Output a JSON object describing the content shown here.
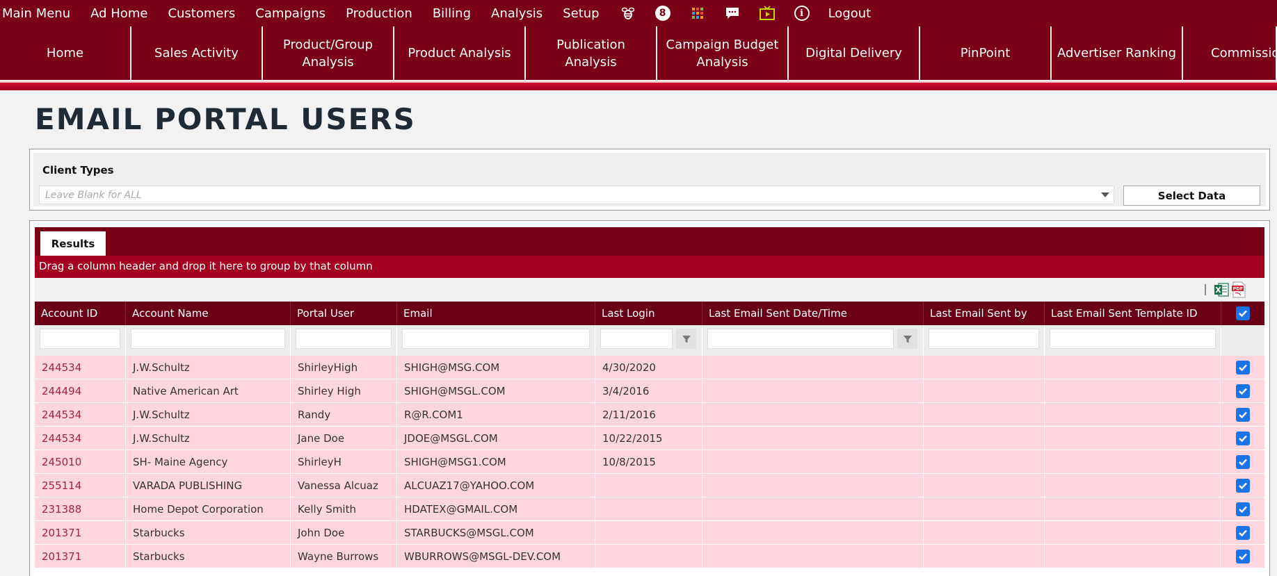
{
  "top_menu": {
    "items": [
      "Main Menu",
      "Ad Home",
      "Customers",
      "Campaigns",
      "Production",
      "Billing",
      "Analysis",
      "Setup"
    ],
    "notification_count": "8",
    "logout_label": "Logout"
  },
  "nav_tabs": [
    "Home",
    "Sales Activity",
    "Product/Group Analysis",
    "Product Analysis",
    "Publication Analysis",
    "Campaign Budget Analysis",
    "Digital Delivery",
    "PinPoint",
    "Advertiser Ranking",
    "Commissions"
  ],
  "page": {
    "title": "EMAIL PORTAL USERS"
  },
  "filters": {
    "client_types_label": "Client Types",
    "client_types_placeholder": "Leave Blank for ALL",
    "select_data_label": "Select Data"
  },
  "results": {
    "tab_label": "Results",
    "group_hint": "Drag a column header and drop it here to group by that column",
    "columns": [
      "Account ID",
      "Account Name",
      "Portal User",
      "Email",
      "Last Login",
      "Last Email Sent Date/Time",
      "Last Email Sent by",
      "Last Email Sent Template ID"
    ],
    "rows": [
      [
        "244534",
        "J.W.Schultz",
        "ShirleyHigh",
        "SHIGH@MSG.COM",
        "4/30/2020",
        "",
        "",
        ""
      ],
      [
        "244494",
        "Native American Art",
        "Shirley High",
        "SHIGH@MSGL.COM",
        "3/4/2016",
        "",
        "",
        ""
      ],
      [
        "244534",
        "J.W.Schultz",
        "Randy",
        "R@R.COM1",
        "2/11/2016",
        "",
        "",
        ""
      ],
      [
        "244534",
        "J.W.Schultz",
        "Jane Doe",
        "JDOE@MSGL.COM",
        "10/22/2015",
        "",
        "",
        ""
      ],
      [
        "245010",
        "SH- Maine Agency",
        "ShirleyH",
        "SHIGH@MSG1.COM",
        "10/8/2015",
        "",
        "",
        ""
      ],
      [
        "255114",
        "VARADA PUBLISHING",
        "Vanessa Alcuaz",
        "ALCUAZ17@YAHOO.COM",
        "",
        "",
        "",
        ""
      ],
      [
        "231388",
        "Home Depot Corporation",
        "Kelly Smith",
        "HDATEX@GMAIL.COM",
        "",
        "",
        "",
        ""
      ],
      [
        "201371",
        "Starbucks",
        "John Doe",
        "STARBUCKS@MSGL.COM",
        "",
        "",
        "",
        ""
      ],
      [
        "201371",
        "Starbucks",
        "Wayne Burrows",
        "WBURROWS@MSGL-DEV.COM",
        "",
        "",
        "",
        ""
      ]
    ]
  },
  "colors": {
    "brand_dark": "#7a0018",
    "brand_red": "#a30020",
    "row_pink": "#ffd6dd",
    "checkbox_blue": "#1a73e8"
  }
}
